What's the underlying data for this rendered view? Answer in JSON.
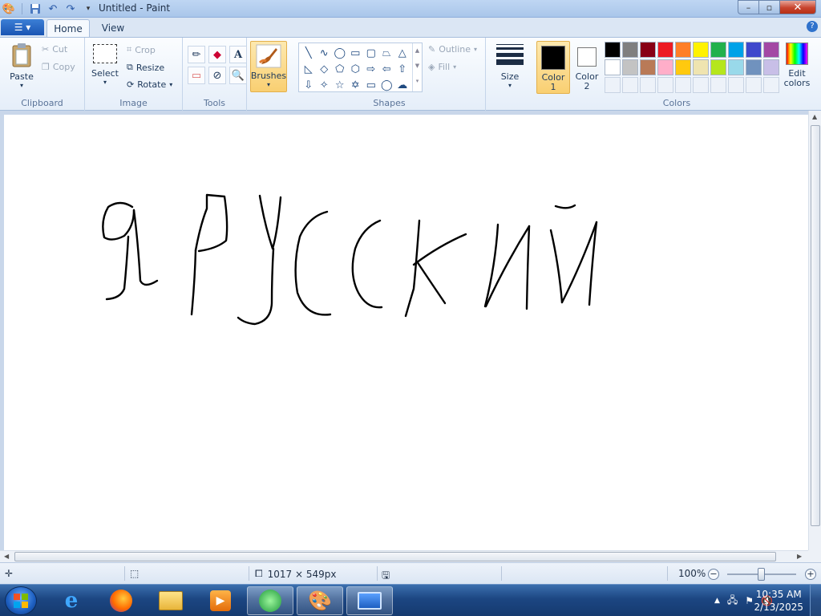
{
  "window": {
    "title": "Untitled - Paint"
  },
  "tabs": {
    "home": "Home",
    "view": "View"
  },
  "ribbon": {
    "clipboard": {
      "label": "Clipboard",
      "paste": "Paste",
      "cut": "Cut",
      "copy": "Copy"
    },
    "image": {
      "label": "Image",
      "select": "Select",
      "crop": "Crop",
      "resize": "Resize",
      "rotate": "Rotate"
    },
    "tools": {
      "label": "Tools"
    },
    "brushes": {
      "label": "Brushes"
    },
    "shapes": {
      "label": "Shapes",
      "outline": "Outline",
      "fill": "Fill"
    },
    "size": {
      "label": "Size"
    },
    "colors": {
      "label": "Colors",
      "color1": "Color\n1",
      "color2": "Color\n2",
      "color1_value": "#000000",
      "color2_value": "#ffffff",
      "edit": "Edit\ncolors",
      "palette": [
        "#000000",
        "#7f7f7f",
        "#880015",
        "#ed1c24",
        "#ff7f27",
        "#fff200",
        "#22b14c",
        "#00a2e8",
        "#3f48cc",
        "#a349a4",
        "#ffffff",
        "#c3c3c3",
        "#b97a57",
        "#ffaec9",
        "#ffc90e",
        "#efe4b0",
        "#b5e61d",
        "#99d9ea",
        "#7092be",
        "#c8bfe7"
      ]
    }
  },
  "status": {
    "dimensions": "1017 × 549px",
    "zoom": "100%"
  },
  "taskbar": {
    "time": "10:35 AM",
    "date": "2/13/2025"
  }
}
